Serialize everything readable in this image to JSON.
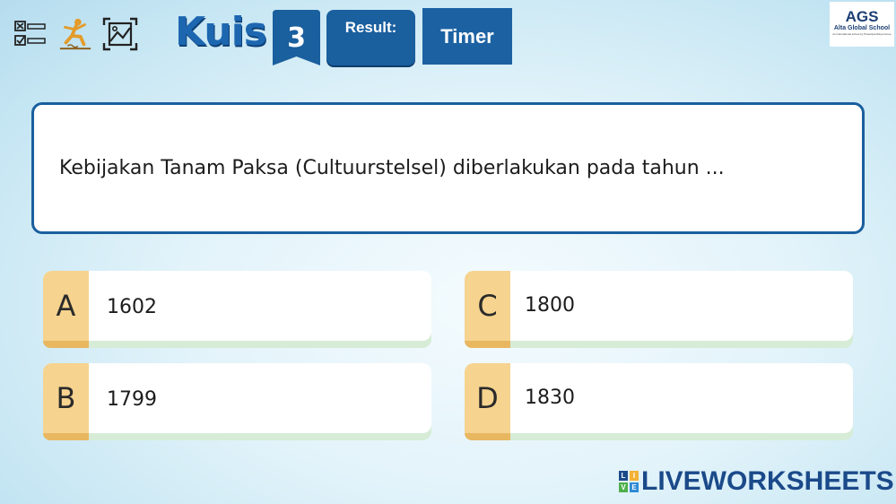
{
  "toolbar": {
    "icons": [
      "checklist-icon",
      "falling-person-icon",
      "fullscreen-image-icon"
    ]
  },
  "header": {
    "title": "Kuis",
    "number": "3",
    "result_label": "Result:",
    "timer_label": "Timer"
  },
  "logo": {
    "name": "AGS",
    "school": "Alta Global School",
    "tagline": "an international school by Prasetiya Mulya Group"
  },
  "question": {
    "text": "Kebijakan Tanam Paksa (Cultuurstelsel) diberlakukan pada tahun ..."
  },
  "options": [
    {
      "letter": "A",
      "value": "1602"
    },
    {
      "letter": "B",
      "value": "1799"
    },
    {
      "letter": "C",
      "value": "1800"
    },
    {
      "letter": "D",
      "value": "1830"
    }
  ],
  "brand": {
    "blocks": [
      "L",
      "I",
      "V",
      "E"
    ],
    "name": "LIVEWORKSHEETS"
  },
  "colors": {
    "primary": "#1a5f9e",
    "option_letter_bg": "#f6d38f",
    "option_shadow": "#d6ecd6"
  }
}
